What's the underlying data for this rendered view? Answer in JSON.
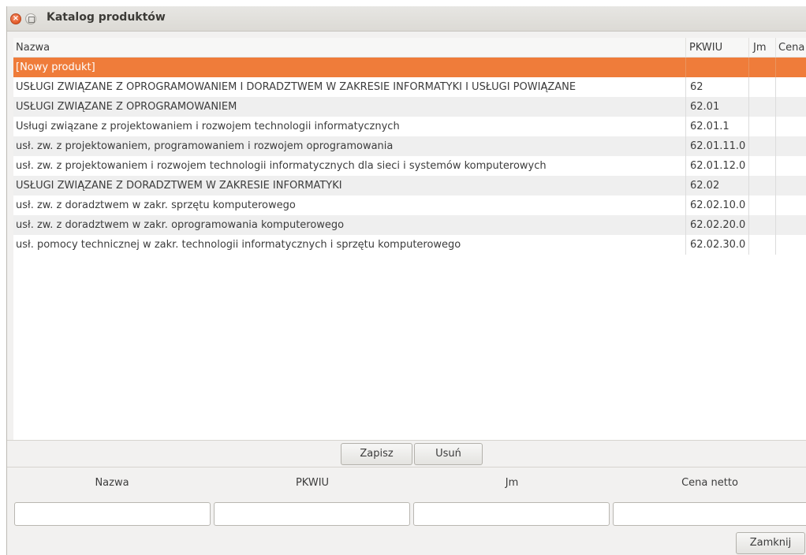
{
  "window": {
    "title": "Katalog produktów",
    "close_glyph": "×"
  },
  "table": {
    "headers": {
      "nazwa": "Nazwa",
      "pkwiu": "PKWIU",
      "jm": "Jm",
      "cena": "Cena"
    },
    "rows": [
      {
        "nazwa": "[Nowy produkt]",
        "pkwiu": "",
        "selected": true
      },
      {
        "nazwa": "USŁUGI ZWIĄZANE Z OPROGRAMOWANIEM I DORADZTWEM W ZAKRESIE INFORMATYKI I USŁUGI POWIĄZANE",
        "pkwiu": "62"
      },
      {
        "nazwa": "USŁUGI ZWIĄZANE Z OPROGRAMOWANIEM",
        "pkwiu": "62.01"
      },
      {
        "nazwa": "Usługi związane z projektowaniem i rozwojem technologii informatycznych",
        "pkwiu": "62.01.1"
      },
      {
        "nazwa": "usł. zw. z projektowaniem, programowaniem i rozwojem oprogramowania",
        "pkwiu": "62.01.11.0"
      },
      {
        "nazwa": "usł. zw. z projektowaniem i rozwojem technologii informatycznych dla sieci i systemów komputerowych",
        "pkwiu": "62.01.12.0"
      },
      {
        "nazwa": "USŁUGI ZWIĄZANE Z DORADZTWEM W ZAKRESIE INFORMATYKI",
        "pkwiu": "62.02"
      },
      {
        "nazwa": "usł. zw. z doradztwem w zakr. sprzętu komputerowego",
        "pkwiu": "62.02.10.0"
      },
      {
        "nazwa": "usł. zw. z doradztwem w zakr. oprogramowania komputerowego",
        "pkwiu": "62.02.20.0"
      },
      {
        "nazwa": "usł. pomocy technicznej w zakr. technologii informatycznych i sprzętu komputerowego",
        "pkwiu": "62.02.30.0"
      }
    ]
  },
  "actions": {
    "save": "Zapisz",
    "delete": "Usuń"
  },
  "form": {
    "labels": {
      "nazwa": "Nazwa",
      "pkwiu": "PKWIU",
      "jm": "Jm",
      "cena": "Cena netto"
    },
    "values": {
      "nazwa": "",
      "pkwiu": "",
      "jm": "",
      "cena": ""
    }
  },
  "footer": {
    "close": "Zamknij"
  },
  "colors": {
    "selection": "#ef7c3a",
    "close_button": "#e25a28"
  }
}
